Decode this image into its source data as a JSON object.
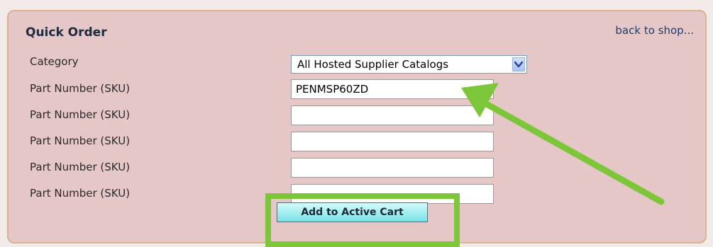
{
  "header": {
    "title": "Quick Order",
    "back_link": "back to shop..."
  },
  "form": {
    "category_label": "Category",
    "category_selected": "All Hosted Supplier Catalogs",
    "sku_rows": [
      {
        "label": "Part Number (SKU)",
        "value": "PENMSP60ZD"
      },
      {
        "label": "Part Number (SKU)",
        "value": ""
      },
      {
        "label": "Part Number (SKU)",
        "value": ""
      },
      {
        "label": "Part Number (SKU)",
        "value": ""
      },
      {
        "label": "Part Number (SKU)",
        "value": ""
      }
    ],
    "submit_label": "Add to Active Cart"
  },
  "annotations": {
    "arrow_color": "#7dc63a",
    "highlight_color": "#7dc63a"
  },
  "icons": {
    "select_arrow": "chevron-down-icon"
  }
}
